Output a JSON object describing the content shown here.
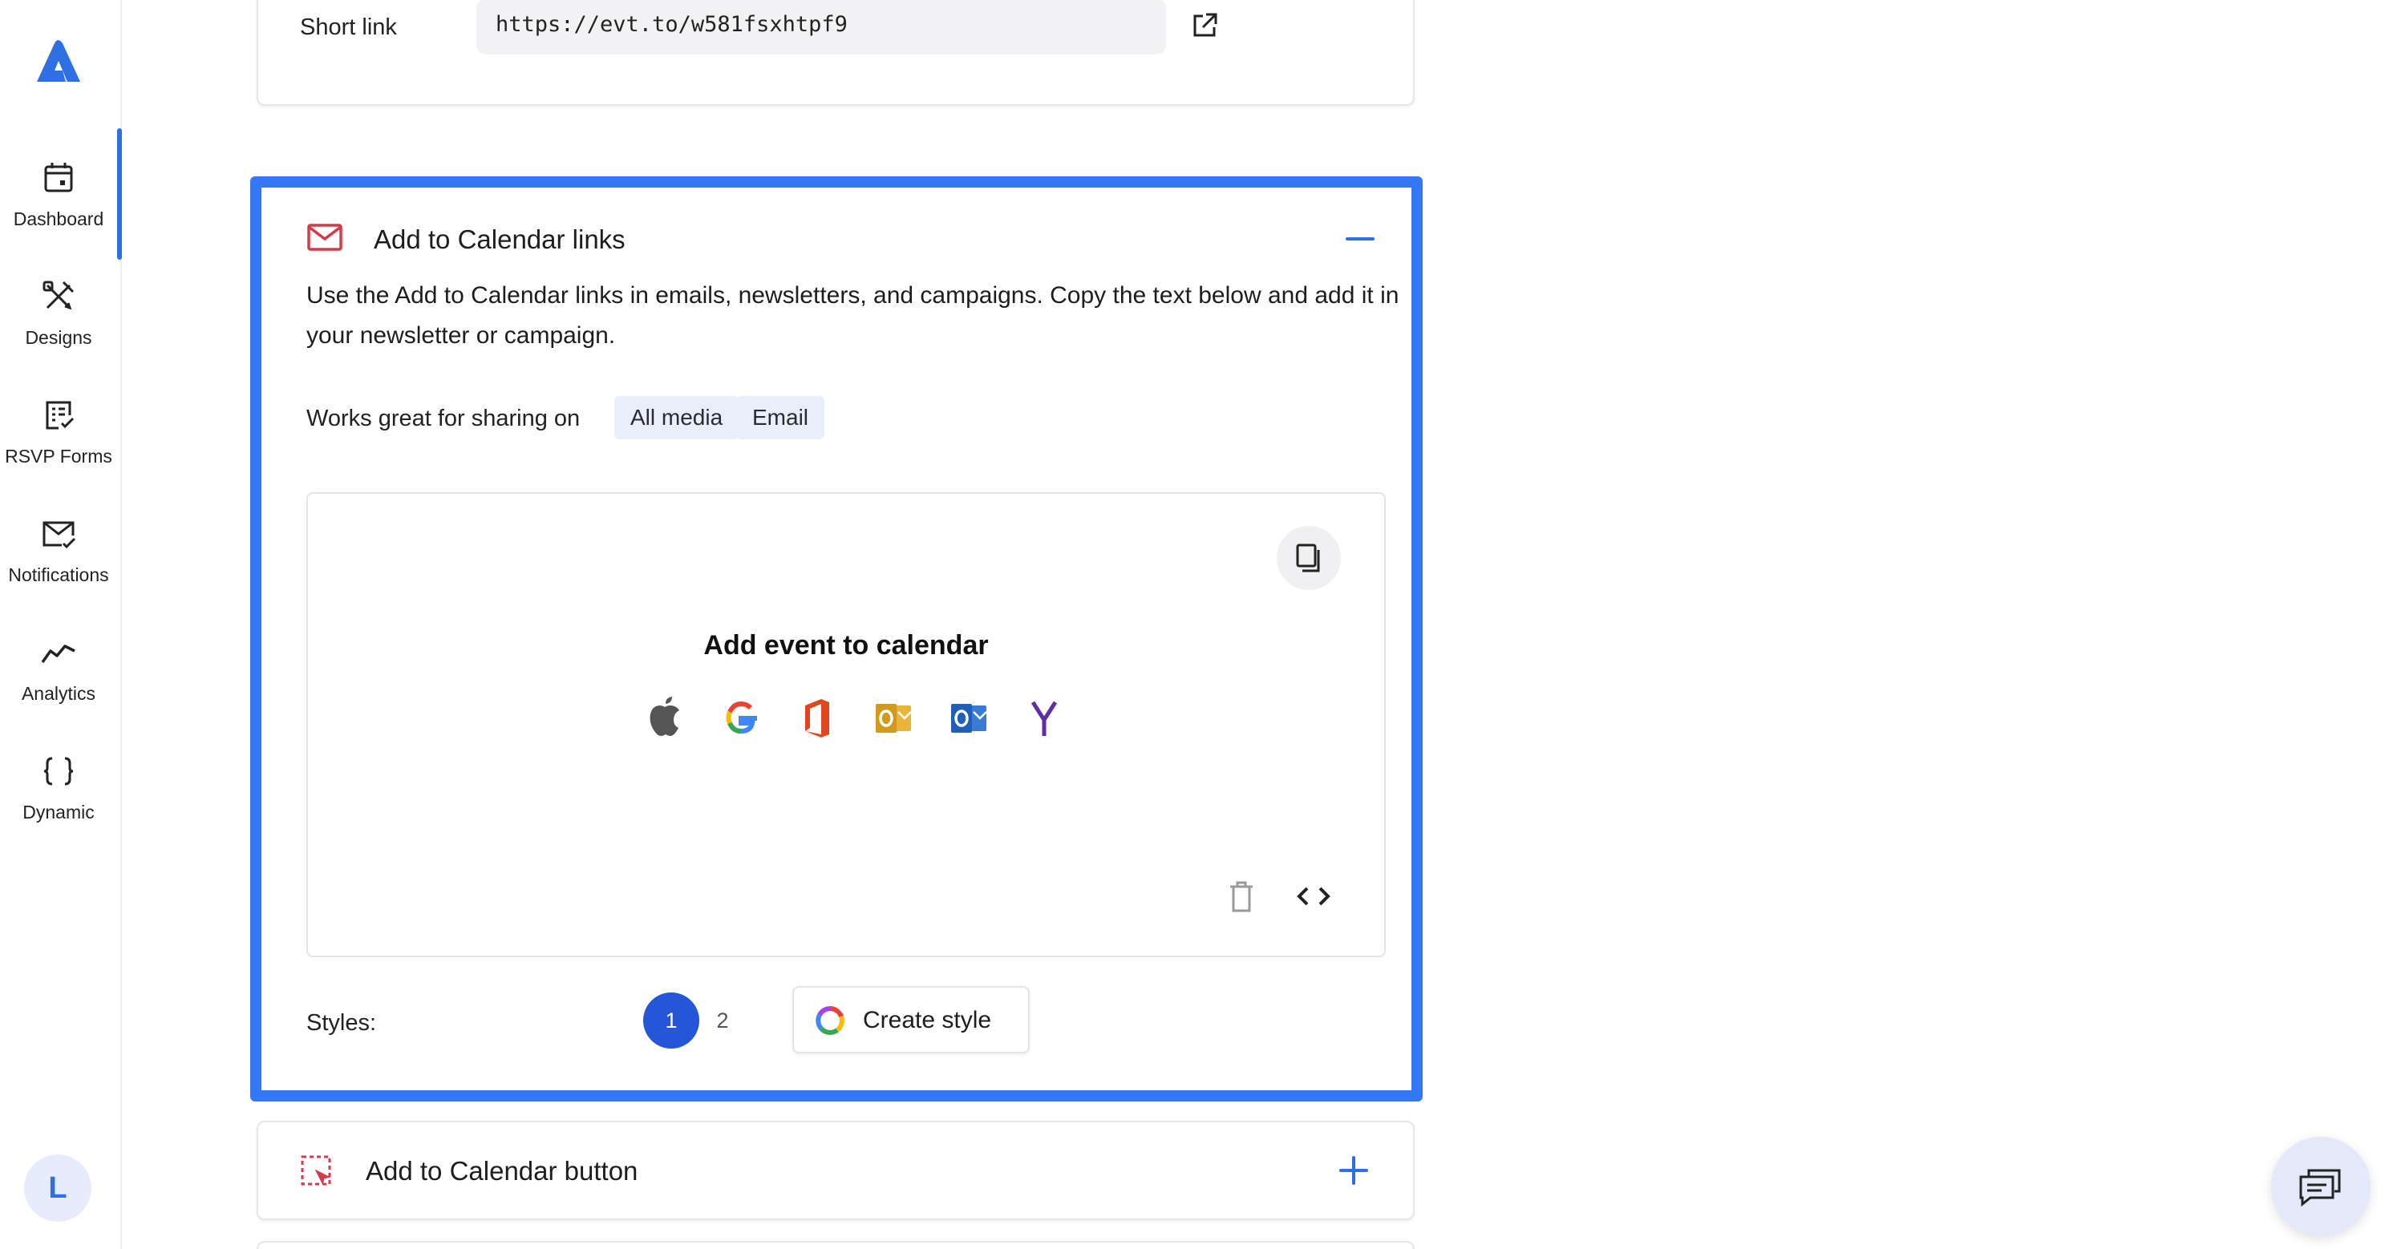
{
  "sidebar": {
    "items": [
      {
        "label": "Dashboard",
        "icon": "calendar-icon",
        "active": true
      },
      {
        "label": "Designs",
        "icon": "designs-icon",
        "active": false
      },
      {
        "label": "RSVP Forms",
        "icon": "rsvp-form-icon",
        "active": false
      },
      {
        "label": "Notifications",
        "icon": "mail-check-icon",
        "active": false
      },
      {
        "label": "Analytics",
        "icon": "analytics-icon",
        "active": false
      },
      {
        "label": "Dynamic",
        "icon": "braces-icon",
        "active": false
      }
    ],
    "avatar_initial": "L",
    "accent": "#2f6fe4"
  },
  "short_link": {
    "label": "Short link",
    "value": "https://evt.to/w581fsxhtpf9"
  },
  "calendar_links_card": {
    "title": "Add to Calendar links",
    "description": "Use the Add to Calendar links in emails, newsletters, and campaigns. Copy the text below and add it in your newsletter or campaign.",
    "works_label": "Works great for sharing on",
    "tags": [
      "All media",
      "Email"
    ],
    "preview": {
      "title": "Add event to calendar",
      "providers": [
        "apple-icon",
        "google-icon",
        "office365-icon",
        "outlook-com-icon",
        "outlook-icon",
        "yahoo-icon"
      ]
    },
    "styles_label": "Styles:",
    "styles": [
      "1",
      "2"
    ],
    "active_style": "1",
    "create_style_label": "Create style",
    "highlight_color": "#3478f6"
  },
  "calendar_button_card": {
    "title": "Add to Calendar button"
  }
}
